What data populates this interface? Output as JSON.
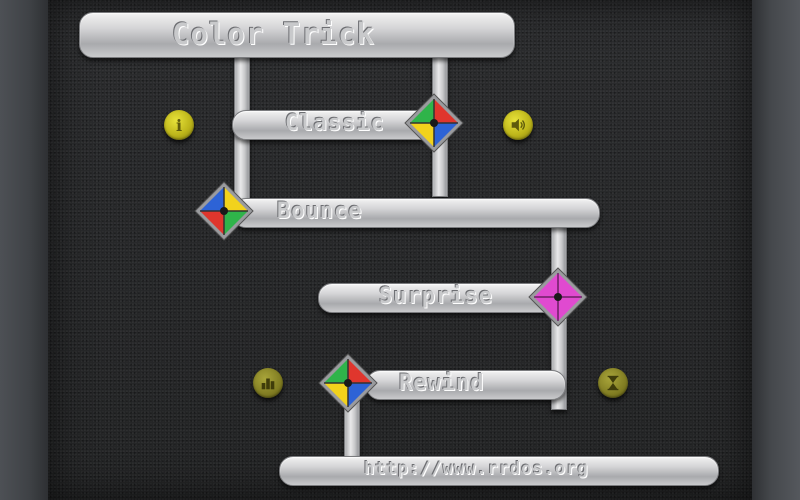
{
  "title": "Color Trick",
  "modes": [
    {
      "label": "Classic",
      "colors": [
        "#2fb44a",
        "#e0362d",
        "#2d63d6",
        "#f2d21c"
      ]
    },
    {
      "label": "Bounce",
      "colors": [
        "#2d63d6",
        "#f2d21c",
        "#e0362d",
        "#2fb44a"
      ]
    },
    {
      "label": "Surprise",
      "colors": [
        "#e04ad0",
        "#e04ad0",
        "#e04ad0",
        "#e04ad0"
      ]
    },
    {
      "label": "Rewind",
      "colors": [
        "#2fb44a",
        "#e0362d",
        "#2d63d6",
        "#f2d21c"
      ]
    }
  ],
  "url": "http://www.rrdos.org",
  "buttons": {
    "info_icon": "info-icon",
    "sound_icon": "speaker-icon",
    "scores_icon": "scores-icon",
    "timer_icon": "hourglass-icon",
    "info_glyph": "i"
  },
  "colors": {
    "board": "#272829",
    "metal": "#d4d4d6",
    "coin": "#bdb51a"
  }
}
